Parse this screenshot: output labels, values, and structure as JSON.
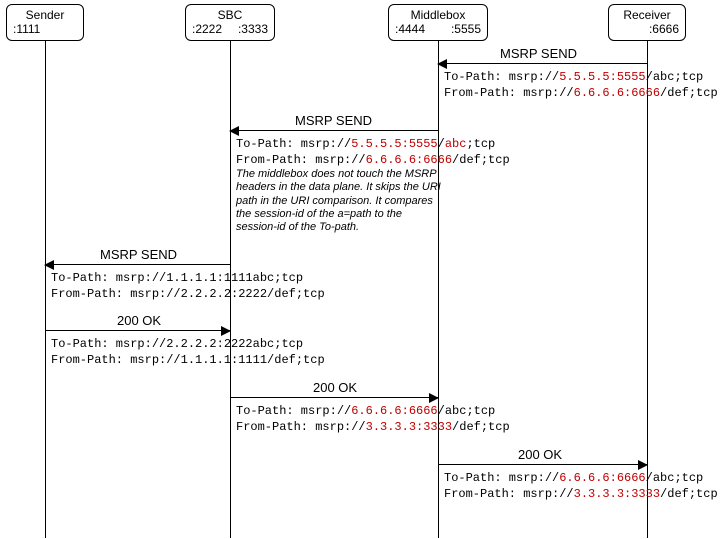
{
  "participants": {
    "sender": {
      "title": "Sender",
      "addr_left": ":1111",
      "addr_right": ""
    },
    "sbc": {
      "title": "SBC",
      "addr_left": ":2222",
      "addr_right": ":3333"
    },
    "middlebox": {
      "title": "Middlebox",
      "addr_left": ":4444",
      "addr_right": ":5555"
    },
    "receiver": {
      "title": "Receiver",
      "addr_left": "",
      "addr_right": ":6666"
    }
  },
  "msgs": {
    "m1": {
      "label": "MSRP SEND",
      "to_pre": "To-Path: msrp://",
      "to_hl": "5.5.5.5:5555",
      "to_post": "/abc;tcp",
      "from_pre": "From-Path: msrp://",
      "from_hl": "6.6.6.6:6666",
      "from_post": "/def;tcp"
    },
    "m2": {
      "label": "MSRP SEND",
      "to_pre": "To-Path: msrp://",
      "to_hl1": "5.5.5.5:5555",
      "to_mid": "/",
      "to_hl2": "abc",
      "to_post": ";tcp",
      "from_pre": "From-Path: msrp://",
      "from_hl": "6.6.6.6:6666",
      "from_post": "/def;tcp"
    },
    "note": "The middlebox does not touch the MSRP headers in the data plane. It skips the URI path in the URI comparison. It compares the session-id of the a=path to the session-id of the To-path.",
    "m3": {
      "label": "MSRP SEND",
      "to": "To-Path: msrp://1.1.1.1:1111abc;tcp",
      "from": "From-Path: msrp://2.2.2.2:2222/def;tcp"
    },
    "m4": {
      "label": "200 OK",
      "to": "To-Path: msrp://2.2.2.2:2222abc;tcp",
      "from": "From-Path: msrp://1.1.1.1:1111/def;tcp"
    },
    "m5": {
      "label": "200 OK",
      "to_pre": "To-Path: msrp://",
      "to_hl": "6.6.6.6:6666",
      "to_post": "/abc;tcp",
      "from_pre": "From-Path: msrp://",
      "from_hl": "3.3.3.3:3333",
      "from_post": "/def;tcp"
    },
    "m6": {
      "label": "200 OK",
      "to_pre": "To-Path: msrp://",
      "to_hl": "6.6.6.6:6666",
      "to_post": "/abc;tcp",
      "from_pre": "From-Path: msrp://",
      "from_hl": "3.3.3.3:3333",
      "from_post": "/def;tcp"
    }
  }
}
